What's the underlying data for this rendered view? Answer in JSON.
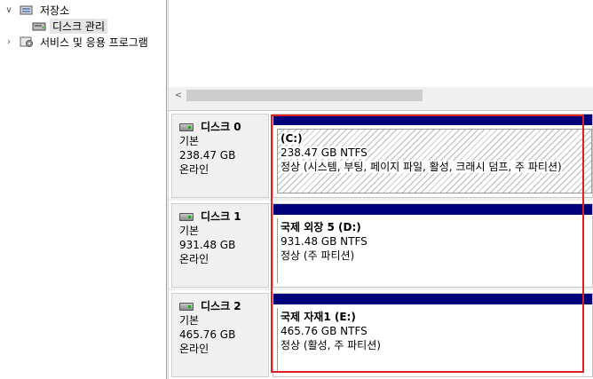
{
  "tree": {
    "items": [
      {
        "label": "저장소",
        "icon": "storage-icon",
        "toggle": "expanded"
      },
      {
        "label": "디스크 관리",
        "icon": "disk-management-icon",
        "selected": true
      },
      {
        "label": "서비스 및 응용 프로그램",
        "icon": "services-apps-icon",
        "toggle": "collapsed"
      }
    ]
  },
  "scrollbar": {
    "left_arrow": "<"
  },
  "disks": [
    {
      "name": "디스크 0",
      "type": "기본",
      "size": "238.47 GB",
      "status": "온라인",
      "partition": {
        "title": "(C:)",
        "size_fs": "238.47 GB NTFS",
        "health": "정상 (시스템, 부팅, 페이지 파일, 활성, 크래시 덤프, 주 파티션)",
        "selected": true
      }
    },
    {
      "name": "디스크 1",
      "type": "기본",
      "size": "931.48 GB",
      "status": "온라인",
      "partition": {
        "title": "국제 외장 5  (D:)",
        "size_fs": "931.48 GB NTFS",
        "health": "정상 (주 파티션)"
      }
    },
    {
      "name": "디스크 2",
      "type": "기본",
      "size": "465.76 GB",
      "status": "온라인",
      "partition": {
        "title": "국제 자재1  (E:)",
        "size_fs": "465.76 GB NTFS",
        "health": "정상 (활성, 주 파티션)"
      }
    }
  ],
  "colors": {
    "partition_bar": "#00007b",
    "highlight": "#e02020",
    "panel_bg": "#f0f0f0"
  }
}
